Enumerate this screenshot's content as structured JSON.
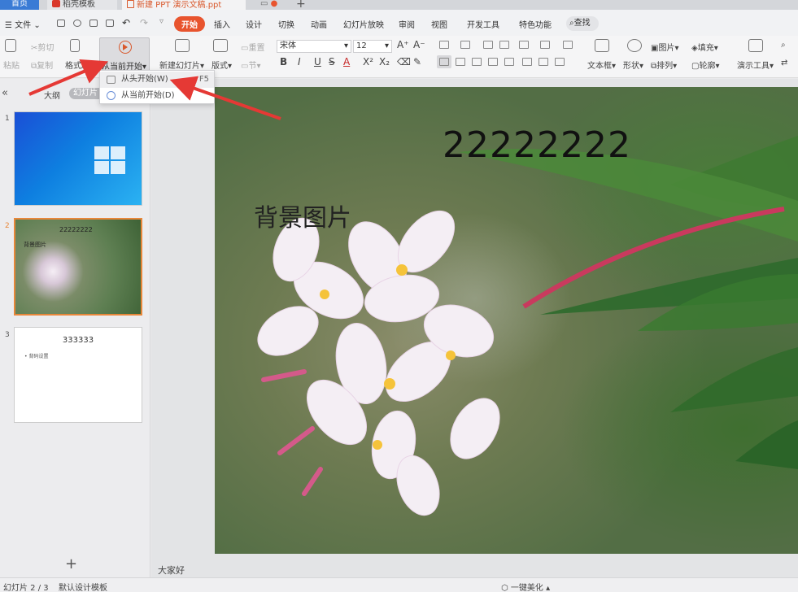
{
  "tabs": {
    "home": "首页",
    "template": "稻壳模板",
    "document": "新建 PPT 演示文稿.ppt"
  },
  "menubar": {
    "file": "文件",
    "items": [
      "开始",
      "插入",
      "设计",
      "切换",
      "动画",
      "幻灯片放映",
      "审阅",
      "视图",
      "开发工具",
      "特色功能"
    ],
    "search": "查找"
  },
  "ribbon": {
    "paste": "粘贴",
    "cut": "剪切",
    "copy": "复制",
    "format_painter": "格式刷",
    "start_from_current": "从当前开始",
    "new_slide": "新建幻灯片",
    "layout": "版式",
    "reset": "重置",
    "section": "节",
    "font_name": "宋体",
    "font_size": "12",
    "bold": "B",
    "italic": "I",
    "underline": "U",
    "strike": "S",
    "font_color": "A",
    "textbox": "文本框",
    "shape": "形状",
    "picture": "图片",
    "arrange": "排列",
    "fill": "填充",
    "outline": "轮廓",
    "presenter_tools": "演示工具"
  },
  "dropdown": {
    "from_beginning": "从头开始(W)",
    "shortcut": "F5",
    "from_current": "从当前开始(D)"
  },
  "leftpanel": {
    "outline_tab": "大纲",
    "slides_tab": "幻灯片",
    "thumb_numbers": [
      "1",
      "2",
      "3"
    ],
    "thumb2_title": "22222222",
    "thumb2_sub": "背景图片",
    "thumb3_title": "333333",
    "thumb3_bullet": "• 背码设置",
    "add": "+"
  },
  "slide": {
    "title": "22222222",
    "subtitle": "背景图片"
  },
  "notes": "大家好",
  "status": {
    "slide_counter": "幻灯片 2 / 3",
    "template": "默认设计模板",
    "beautify": "一键美化"
  },
  "colors": {
    "accent": "#e8542e",
    "annotation_arrow": "#e53935"
  }
}
